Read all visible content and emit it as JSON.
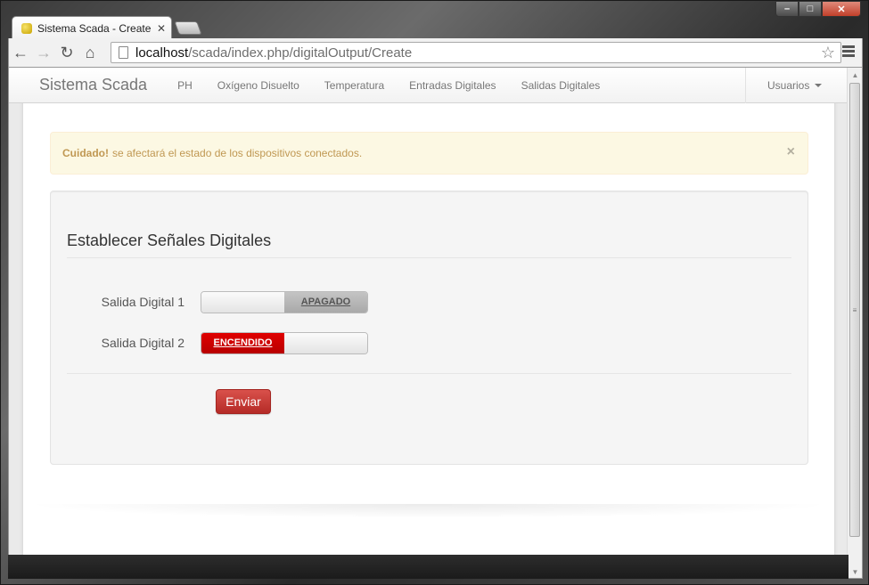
{
  "browser": {
    "tab_title": "Sistema Scada - Create Di",
    "url_host": "localhost",
    "url_path": "/scada/index.php/digitalOutput/Create"
  },
  "navbar": {
    "brand": "Sistema Scada",
    "links": [
      {
        "label": "PH"
      },
      {
        "label": "Oxígeno Disuelto"
      },
      {
        "label": "Temperatura"
      },
      {
        "label": "Entradas Digitales"
      },
      {
        "label": "Salidas Digitales"
      }
    ],
    "user_menu": "Usuarios"
  },
  "alert": {
    "strong": "Cuidado!",
    "text": "se afectará el estado de los dispositivos conectados.",
    "close": "×"
  },
  "form": {
    "legend": "Establecer Señales Digitales",
    "outputs": [
      {
        "label": "Salida Digital 1",
        "state_text": "APAGADO",
        "state": "off"
      },
      {
        "label": "Salida Digital 2",
        "state_text": "ENCENDIDO",
        "state": "on"
      }
    ],
    "submit_label": "Enviar"
  },
  "colors": {
    "alert_bg": "#fcf8e3",
    "alert_text": "#c09853",
    "toggle_on": "#cc0000",
    "button_danger": "#c9302c"
  },
  "icons": {
    "back": "back-arrow-icon",
    "forward": "forward-arrow-icon",
    "reload": "reload-icon",
    "home": "home-icon",
    "bookmark": "star-icon",
    "menu": "menu-icon"
  }
}
